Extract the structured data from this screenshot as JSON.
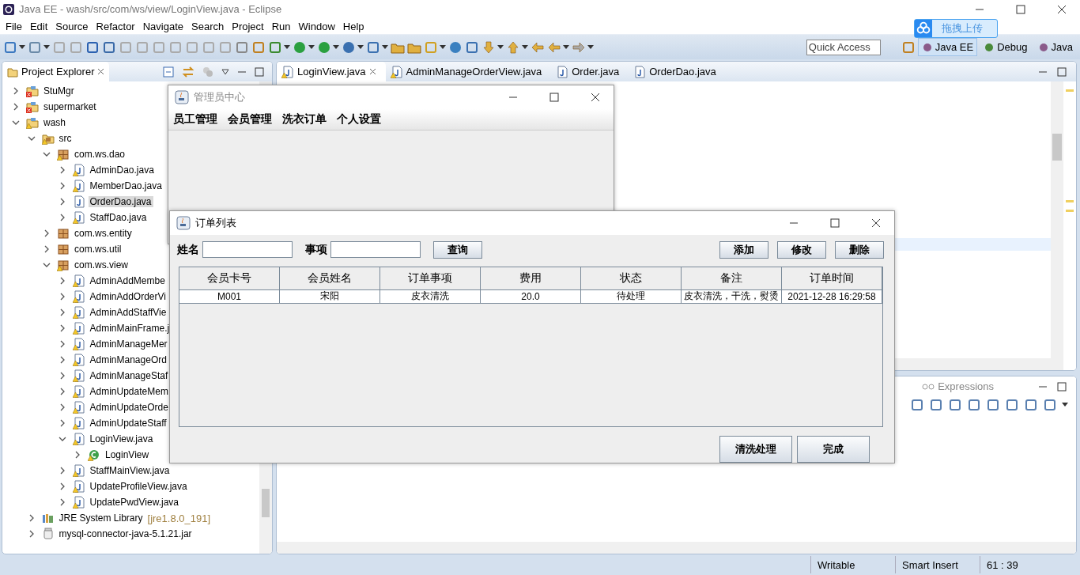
{
  "window": {
    "title": "Java EE - wash/src/com/ws/view/LoginView.java - Eclipse"
  },
  "menu": [
    "File",
    "Edit",
    "Source",
    "Refactor",
    "Navigate",
    "Search",
    "Project",
    "Run",
    "Window",
    "Help"
  ],
  "quick_access": {
    "placeholder": "Quick Access"
  },
  "perspectives": [
    {
      "label": "Java EE",
      "selected": true
    },
    {
      "label": "Debug",
      "selected": false
    },
    {
      "label": "Java",
      "selected": false
    }
  ],
  "upload_badge": {
    "label": "拖拽上传"
  },
  "project_explorer": {
    "title": "Project Explorer",
    "tree": [
      {
        "label": "StuMgr",
        "kind": "project",
        "error": true,
        "warning": false,
        "expanded": false,
        "selected": false
      },
      {
        "label": "supermarket",
        "kind": "project",
        "error": true,
        "warning": false,
        "expanded": false,
        "selected": false
      },
      {
        "label": "wash",
        "kind": "project",
        "error": false,
        "warning": true,
        "expanded": true,
        "selected": false,
        "children": [
          {
            "label": "src",
            "kind": "source-folder",
            "warning": true,
            "expanded": true,
            "selected": false,
            "children": [
              {
                "label": "com.ws.dao",
                "kind": "package",
                "warning": true,
                "expanded": true,
                "selected": false,
                "children": [
                  {
                    "label": "AdminDao.java",
                    "kind": "java-file",
                    "warning": true,
                    "expanded": false,
                    "selected": false
                  },
                  {
                    "label": "MemberDao.java",
                    "kind": "java-file",
                    "warning": true,
                    "expanded": false,
                    "selected": false
                  },
                  {
                    "label": "OrderDao.java",
                    "kind": "java-file",
                    "warning": false,
                    "expanded": false,
                    "selected": true
                  },
                  {
                    "label": "StaffDao.java",
                    "kind": "java-file",
                    "warning": true,
                    "expanded": false,
                    "selected": false
                  }
                ]
              },
              {
                "label": "com.ws.entity",
                "kind": "package",
                "warning": false,
                "expanded": false,
                "selected": false
              },
              {
                "label": "com.ws.util",
                "kind": "package",
                "warning": false,
                "expanded": false,
                "selected": false
              },
              {
                "label": "com.ws.view",
                "kind": "package",
                "warning": true,
                "expanded": true,
                "selected": false,
                "children": [
                  {
                    "label": "AdminAddMembe",
                    "kind": "java-file",
                    "warning": true,
                    "expanded": false,
                    "selected": false
                  },
                  {
                    "label": "AdminAddOrderVi",
                    "kind": "java-file",
                    "warning": true,
                    "expanded": false,
                    "selected": false
                  },
                  {
                    "label": "AdminAddStaffVie",
                    "kind": "java-file",
                    "warning": true,
                    "expanded": false,
                    "selected": false
                  },
                  {
                    "label": "AdminMainFrame.j",
                    "kind": "java-file",
                    "warning": true,
                    "expanded": false,
                    "selected": false
                  },
                  {
                    "label": "AdminManageMer",
                    "kind": "java-file",
                    "warning": true,
                    "expanded": false,
                    "selected": false
                  },
                  {
                    "label": "AdminManageOrd",
                    "kind": "java-file",
                    "warning": true,
                    "expanded": false,
                    "selected": false
                  },
                  {
                    "label": "AdminManageStaf",
                    "kind": "java-file",
                    "warning": true,
                    "expanded": false,
                    "selected": false
                  },
                  {
                    "label": "AdminUpdateMem",
                    "kind": "java-file",
                    "warning": true,
                    "expanded": false,
                    "selected": false
                  },
                  {
                    "label": "AdminUpdateOrde",
                    "kind": "java-file",
                    "warning": true,
                    "expanded": false,
                    "selected": false
                  },
                  {
                    "label": "AdminUpdateStaff",
                    "kind": "java-file",
                    "warning": true,
                    "expanded": false,
                    "selected": false
                  },
                  {
                    "label": "LoginView.java",
                    "kind": "java-file",
                    "warning": true,
                    "expanded": true,
                    "selected": false,
                    "children": [
                      {
                        "label": "LoginView",
                        "kind": "class",
                        "warning": true,
                        "expanded": false,
                        "selected": false
                      }
                    ]
                  },
                  {
                    "label": "StaffMainView.java",
                    "kind": "java-file",
                    "warning": true,
                    "expanded": false,
                    "selected": false
                  },
                  {
                    "label": "UpdateProfileView.java",
                    "kind": "java-file",
                    "warning": true,
                    "expanded": false,
                    "selected": false
                  },
                  {
                    "label": "UpdatePwdView.java",
                    "kind": "java-file",
                    "warning": true,
                    "expanded": false,
                    "selected": false
                  }
                ]
              }
            ]
          },
          {
            "label": "JRE System Library",
            "decoration": "[jre1.8.0_191]",
            "kind": "library",
            "warning": false,
            "expanded": false,
            "selected": false
          },
          {
            "label": "mysql-connector-java-5.1.21.jar",
            "kind": "jar",
            "warning": false,
            "expanded": false,
            "selected": false
          }
        ]
      }
    ]
  },
  "editor": {
    "tabs": [
      {
        "label": "LoginView.java",
        "selected": true,
        "warning": true
      },
      {
        "label": "AdminManageOrderView.java",
        "selected": false,
        "warning": true
      },
      {
        "label": "Order.java",
        "selected": false,
        "warning": false
      },
      {
        "label": "OrderDao.java",
        "selected": false,
        "warning": false
      }
    ]
  },
  "lower_panel": {
    "tabs": [
      {
        "label": "Expressions"
      }
    ]
  },
  "status_bar": [
    "Writable",
    "Smart Insert",
    "61 : 39"
  ],
  "admin_window": {
    "title": "管理员中心",
    "menu": [
      "员工管理",
      "会员管理",
      "洗衣订单",
      "个人设置"
    ]
  },
  "order_dialog": {
    "title": "订单列表",
    "filters": [
      {
        "label": "姓名"
      },
      {
        "label": "事项"
      }
    ],
    "search_button": "查询",
    "actions": [
      "添加",
      "修改",
      "删除"
    ],
    "table": {
      "columns": [
        "会员卡号",
        "会员姓名",
        "订单事项",
        "费用",
        "状态",
        "备注",
        "订单时间"
      ],
      "rows": [
        [
          "M001",
          "宋阳",
          "皮衣清洗",
          "20.0",
          "待处理",
          "皮衣清洗，干洗，熨烫",
          "2021-12-28 16:29:58"
        ]
      ]
    },
    "bottom_buttons": [
      "清洗处理",
      "完成"
    ]
  }
}
